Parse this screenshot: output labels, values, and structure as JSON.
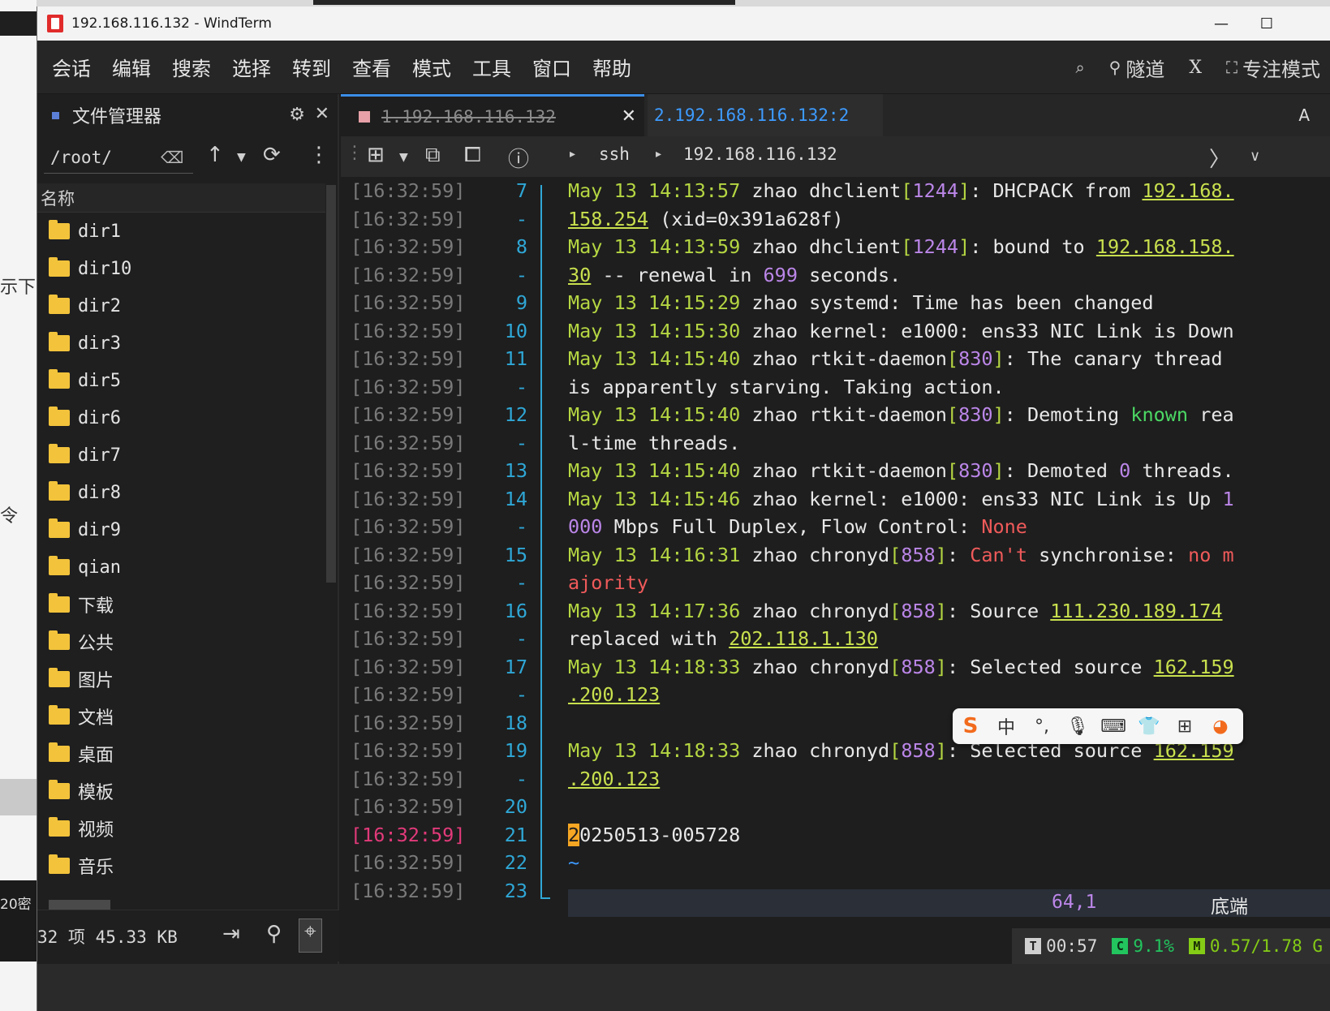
{
  "window": {
    "title": "192.168.116.132 - WindTerm"
  },
  "menu": {
    "items": [
      "会话",
      "编辑",
      "搜索",
      "选择",
      "转到",
      "查看",
      "模式",
      "工具",
      "窗口",
      "帮助"
    ],
    "right": {
      "tunnel": "隧道",
      "x": "X",
      "focus": "专注模式"
    }
  },
  "file_manager": {
    "title": "文件管理器",
    "path": "/root/",
    "column_header": "名称",
    "items": [
      "dir1",
      "dir10",
      "dir2",
      "dir3",
      "dir5",
      "dir6",
      "dir7",
      "dir8",
      "dir9",
      "qian",
      "下载",
      "公共",
      "图片",
      "文档",
      "桌面",
      "模板",
      "视频",
      "音乐"
    ],
    "status": "32 项 45.33 KB"
  },
  "tabs": {
    "tab1": "1.192.168.116.132",
    "tab2": "2.192.168.116.132:2",
    "right_label": "A"
  },
  "breadcrumb": {
    "proto": "ssh",
    "host": "192.168.116.132"
  },
  "gutter": [
    {
      "ts": "[16:32:59]",
      "ln": "7"
    },
    {
      "ts": "[16:32:59]",
      "ln": "-"
    },
    {
      "ts": "[16:32:59]",
      "ln": "8"
    },
    {
      "ts": "[16:32:59]",
      "ln": "-"
    },
    {
      "ts": "[16:32:59]",
      "ln": "9"
    },
    {
      "ts": "[16:32:59]",
      "ln": "10"
    },
    {
      "ts": "[16:32:59]",
      "ln": "11"
    },
    {
      "ts": "[16:32:59]",
      "ln": "-"
    },
    {
      "ts": "[16:32:59]",
      "ln": "12"
    },
    {
      "ts": "[16:32:59]",
      "ln": "-"
    },
    {
      "ts": "[16:32:59]",
      "ln": "13"
    },
    {
      "ts": "[16:32:59]",
      "ln": "14"
    },
    {
      "ts": "[16:32:59]",
      "ln": "-"
    },
    {
      "ts": "[16:32:59]",
      "ln": "15"
    },
    {
      "ts": "[16:32:59]",
      "ln": "-"
    },
    {
      "ts": "[16:32:59]",
      "ln": "16"
    },
    {
      "ts": "[16:32:59]",
      "ln": "-"
    },
    {
      "ts": "[16:32:59]",
      "ln": "17"
    },
    {
      "ts": "[16:32:59]",
      "ln": "-"
    },
    {
      "ts": "[16:32:59]",
      "ln": "18"
    },
    {
      "ts": "[16:32:59]",
      "ln": "19"
    },
    {
      "ts": "[16:32:59]",
      "ln": "-"
    },
    {
      "ts": "[16:32:59]",
      "ln": "20"
    },
    {
      "ts": "[16:32:59]",
      "ln": "21",
      "hl": true
    },
    {
      "ts": "[16:32:59]",
      "ln": "22"
    },
    {
      "ts": "[16:32:59]",
      "ln": "23"
    }
  ],
  "lines": [
    [
      [
        "c-date",
        "May 13 14:13:57"
      ],
      [
        "c-proc",
        " zhao dhclient"
      ],
      [
        "c-br",
        "["
      ],
      [
        "c-pid",
        "1244"
      ],
      [
        "c-br",
        "]"
      ],
      [
        "c-proc",
        ": DHCPACK from "
      ],
      [
        "c-ip",
        "192.168."
      ]
    ],
    [
      [
        "c-ip",
        "158.254"
      ],
      [
        "c-proc",
        " (xid="
      ],
      [
        "c-proc",
        "0x391a628f"
      ],
      [
        "c-proc",
        ")"
      ]
    ],
    [
      [
        "c-date",
        "May 13 14:13:59"
      ],
      [
        "c-proc",
        " zhao dhclient"
      ],
      [
        "c-br",
        "["
      ],
      [
        "c-pid",
        "1244"
      ],
      [
        "c-br",
        "]"
      ],
      [
        "c-proc",
        ": bound to "
      ],
      [
        "c-ip",
        "192.168.158."
      ]
    ],
    [
      [
        "c-ip",
        "30"
      ],
      [
        "c-proc",
        " -- renewal in "
      ],
      [
        "c-num",
        "699"
      ],
      [
        "c-proc",
        " seconds."
      ]
    ],
    [
      [
        "c-date",
        "May 13 14:15:29"
      ],
      [
        "c-proc",
        " zhao systemd: Time has been changed"
      ]
    ],
    [
      [
        "c-date",
        "May 13 14:15:30"
      ],
      [
        "c-proc",
        " zhao kernel: e1000: ens33 NIC Link is Down"
      ]
    ],
    [
      [
        "c-date",
        "May 13 14:15:40"
      ],
      [
        "c-proc",
        " zhao rtkit-daemon"
      ],
      [
        "c-br",
        "["
      ],
      [
        "c-pid",
        "830"
      ],
      [
        "c-br",
        "]"
      ],
      [
        "c-proc",
        ": The canary thread"
      ]
    ],
    [
      [
        "c-proc",
        "is apparently starving. Taking action."
      ]
    ],
    [
      [
        "c-date",
        "May 13 14:15:40"
      ],
      [
        "c-proc",
        " zhao rtkit-daemon"
      ],
      [
        "c-br",
        "["
      ],
      [
        "c-pid",
        "830"
      ],
      [
        "c-br",
        "]"
      ],
      [
        "c-proc",
        ": Demoting "
      ],
      [
        "c-green",
        "known"
      ],
      [
        "c-proc",
        " rea"
      ]
    ],
    [
      [
        "c-proc",
        "l-time threads."
      ]
    ],
    [
      [
        "c-date",
        "May 13 14:15:40"
      ],
      [
        "c-proc",
        " zhao rtkit-daemon"
      ],
      [
        "c-br",
        "["
      ],
      [
        "c-pid",
        "830"
      ],
      [
        "c-br",
        "]"
      ],
      [
        "c-proc",
        ": Demoted "
      ],
      [
        "c-num",
        "0"
      ],
      [
        "c-proc",
        " threads."
      ]
    ],
    [
      [
        "c-date",
        "May 13 14:15:46"
      ],
      [
        "c-proc",
        " zhao kernel: e1000: ens33 NIC Link is Up "
      ],
      [
        "c-num",
        "1"
      ]
    ],
    [
      [
        "c-num",
        "000"
      ],
      [
        "c-proc",
        " Mbps Full Duplex, Flow Control: "
      ],
      [
        "c-red",
        "None"
      ]
    ],
    [
      [
        "c-date",
        "May 13 14:16:31"
      ],
      [
        "c-proc",
        " zhao chronyd"
      ],
      [
        "c-br",
        "["
      ],
      [
        "c-pid",
        "858"
      ],
      [
        "c-br",
        "]"
      ],
      [
        "c-proc",
        ": "
      ],
      [
        "c-red",
        "Can't"
      ],
      [
        "c-proc",
        " synchronise: "
      ],
      [
        "c-red",
        "no m"
      ]
    ],
    [
      [
        "c-red",
        "ajority"
      ]
    ],
    [
      [
        "c-date",
        "May 13 14:17:36"
      ],
      [
        "c-proc",
        " zhao chronyd"
      ],
      [
        "c-br",
        "["
      ],
      [
        "c-pid",
        "858"
      ],
      [
        "c-br",
        "]"
      ],
      [
        "c-proc",
        ": Source "
      ],
      [
        "c-ip",
        "111.230.189.174"
      ]
    ],
    [
      [
        "c-proc",
        "replaced with "
      ],
      [
        "c-ip",
        "202.118.1.130"
      ]
    ],
    [
      [
        "c-date",
        "May 13 14:18:33"
      ],
      [
        "c-proc",
        " zhao chronyd"
      ],
      [
        "c-br",
        "["
      ],
      [
        "c-pid",
        "858"
      ],
      [
        "c-br",
        "]"
      ],
      [
        "c-proc",
        ": Selected source "
      ],
      [
        "c-ip",
        "162.159"
      ]
    ],
    [
      [
        "c-ip",
        ".200.123"
      ]
    ],
    [],
    [
      [
        "c-date",
        "May 13 14:18:33"
      ],
      [
        "c-proc",
        " zhao chronyd"
      ],
      [
        "c-br",
        "["
      ],
      [
        "c-pid",
        "858"
      ],
      [
        "c-br",
        "]"
      ],
      [
        "c-proc",
        ": Selected source "
      ],
      [
        "c-ip",
        "162.159"
      ]
    ],
    [
      [
        "c-ip",
        ".200.123"
      ]
    ],
    [],
    [
      [
        "c-cursor",
        "2"
      ],
      [
        "c-proc",
        "0250513-005728"
      ]
    ],
    [
      [
        "c-tilde",
        "~"
      ]
    ],
    []
  ],
  "vim": {
    "position": "64,1",
    "scroll": "底端"
  },
  "ime": {
    "brand": "S",
    "mode": "中"
  },
  "sysstat": {
    "t_label": "T",
    "time": "00:57",
    "c_label": "C",
    "cpu": "9.1%",
    "m_label": "M",
    "mem": "0.57/1.78 G"
  }
}
